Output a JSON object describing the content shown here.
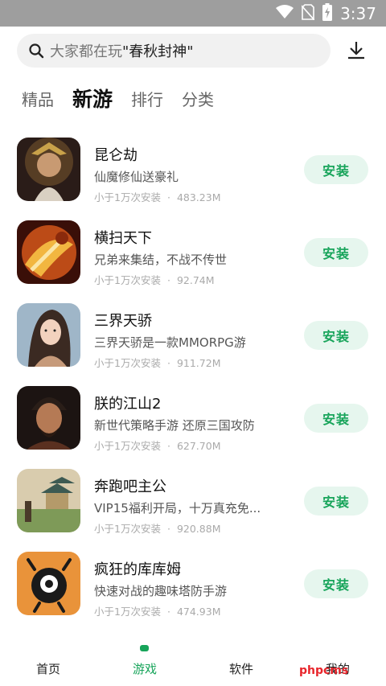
{
  "status_bar": {
    "time": "3:37",
    "icons": [
      "wifi-icon",
      "no-sim-icon",
      "battery-icon"
    ]
  },
  "search": {
    "prefix": "大家都在玩",
    "keyword": "\"春秋封神\"",
    "icon": "search-icon",
    "download_icon": "download-icon"
  },
  "tabs": [
    {
      "label": "精品",
      "active": false
    },
    {
      "label": "新游",
      "active": true
    },
    {
      "label": "排行",
      "active": false
    },
    {
      "label": "分类",
      "active": false
    }
  ],
  "games": [
    {
      "title": "昆仑劫",
      "desc": "仙魔修仙送豪礼",
      "installs": "小于1万次安装",
      "size": "483.23M",
      "button": "安装"
    },
    {
      "title": "横扫天下",
      "desc": "兄弟来集结，不战不传世",
      "installs": "小于1万次安装",
      "size": "92.74M",
      "button": "安装"
    },
    {
      "title": "三界天骄",
      "desc": "三界天骄是一款MMORPG游",
      "installs": "小于1万次安装",
      "size": "911.72M",
      "button": "安装"
    },
    {
      "title": "朕的江山2",
      "desc": "新世代策略手游 还原三国攻防",
      "installs": "小于1万次安装",
      "size": "627.70M",
      "button": "安装"
    },
    {
      "title": "奔跑吧主公",
      "desc": "VIP15福利开局，十万真充免...",
      "installs": "小于1万次安装",
      "size": "920.88M",
      "button": "安装"
    },
    {
      "title": "疯狂的库库姆",
      "desc": "快速对战的趣味塔防手游",
      "installs": "小于1万次安装",
      "size": "474.93M",
      "button": "安装"
    }
  ],
  "meta_separator": "·",
  "bottom_nav": [
    {
      "label": "首页",
      "active": false
    },
    {
      "label": "游戏",
      "active": true
    },
    {
      "label": "软件",
      "active": false
    },
    {
      "label": "我的",
      "active": false
    }
  ],
  "watermark": "phpcms",
  "colors": {
    "accent": "#17a45a",
    "install_bg": "#e6f6ee",
    "status_bar": "#9e9e9e",
    "search_bg": "#f1f1f1"
  }
}
